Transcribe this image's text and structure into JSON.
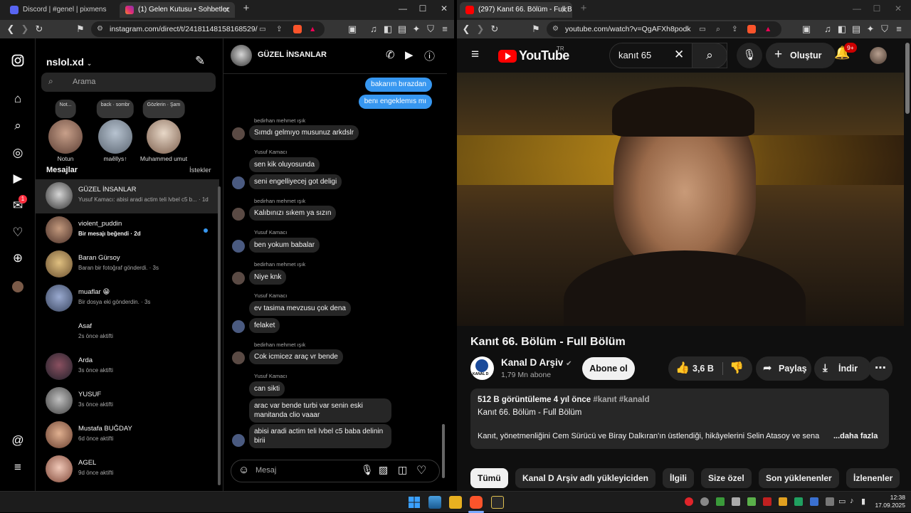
{
  "left_browser": {
    "tabs": [
      {
        "label": "Discord | #genel | pixmens"
      },
      {
        "label": "(1) Gelen Kutusu • Sohbetler"
      }
    ],
    "url": "instagram.com/direct/t/24181148158168529/"
  },
  "instagram": {
    "username": "nslol.xd",
    "search_placeholder": "Arama",
    "rail_badge": "1",
    "notes": [
      {
        "bubble": "Not...",
        "name": "Notun"
      },
      {
        "bubble": "back · sombr",
        "name": "maêllys↑"
      },
      {
        "bubble": "Gözlerin · Şam",
        "name": "Muhammed umut"
      }
    ],
    "messages_heading": "Mesajlar",
    "requests_link": "İstekler",
    "conversations": [
      {
        "name": "GÜZEL İNSANLAR",
        "snippet": "Yusuf Kamacı: abisi aradi actim teli lvbel c5 b... · 1d",
        "bold": false
      },
      {
        "name": "violent_puddin",
        "snippet": "Bir mesajı beğendi · 2d",
        "bold": true
      },
      {
        "name": "Baran Gürsoy",
        "snippet": "Baran bir fotoğraf gönderdi. · 3s",
        "bold": false
      },
      {
        "name": "muaflar 😁",
        "snippet": "Bir dosya eki gönderdin. · 3s",
        "bold": false
      },
      {
        "name": "Asaf",
        "snippet": "2s önce aktifti",
        "bold": false
      },
      {
        "name": "Arda",
        "snippet": "3s önce aktifti",
        "bold": false
      },
      {
        "name": "YUSUF",
        "snippet": "3s önce aktifti",
        "bold": false
      },
      {
        "name": "Mustafa BUĞDAY",
        "snippet": "6d önce aktifti",
        "bold": false
      },
      {
        "name": "AGEL",
        "snippet": "9d önce aktifti",
        "bold": false
      }
    ],
    "chat": {
      "title": "GÜZEL İNSANLAR",
      "input_placeholder": "Mesaj",
      "my_messages": [
        "bakarım bırazdan",
        "benı engeklemıs mı"
      ],
      "messages": [
        {
          "sender": "bedirhan mehmet ışık",
          "text": "Sımdı gelmıyo musunuz arkdslr"
        },
        {
          "sender": "Yusuf Kamacı",
          "text": "sen kik oluyosunda"
        },
        {
          "sender": "",
          "text": "seni engelliyecej got deligi"
        },
        {
          "sender": "bedirhan mehmet ışık",
          "text": "Kalıbınızı sıkem ya sızın"
        },
        {
          "sender": "Yusuf Kamacı",
          "text": "ben yokum babalar"
        },
        {
          "sender": "bedirhan mehmet ışık",
          "text": "Niye knk"
        },
        {
          "sender": "Yusuf Kamacı",
          "text": "ev tasima mevzusu çok dena"
        },
        {
          "sender": "",
          "text": "felaket"
        },
        {
          "sender": "bedirhan mehmet ışık",
          "text": "Cok icmicez araç vr bende"
        },
        {
          "sender": "Yusuf Kamacı",
          "text": "can sikti"
        },
        {
          "sender": "",
          "text": "arac var bende turbi var senin eski manitanda clio vaaar"
        },
        {
          "sender": "",
          "text": "abisi aradi actim teli lvbel c5 baba delinin birii"
        }
      ]
    }
  },
  "right_browser": {
    "tab": "(297) Kanıt 66. Bölüm - Full B...",
    "url": "youtube.com/watch?v=QgAFXh8podk"
  },
  "youtube": {
    "logo_text": "YouTube",
    "region": "TR",
    "search_value": "kanıt 65",
    "create_label": "Oluştur",
    "notif_count": "9+",
    "title": "Kanıt 66. Bölüm - Full Bölüm",
    "channel": "Kanal D Arşiv",
    "channel_logo_text": "KANAL D",
    "subs": "1,79 Mn abone",
    "subscribe": "Abone ol",
    "likes": "3,6 B",
    "share": "Paylaş",
    "download": "İndir",
    "desc_stats": "512 B görüntüleme  4 yıl önce",
    "desc_tags": "#kanıt #kanald",
    "desc_line2": "Kanıt 66. Bölüm - Full Bölüm",
    "desc_line3": "Kanıt, yönetmenliğini Cem Sürücü ve Biray Dalkıran'ın üstlendiği, hikâyelerini Selin Atasoy ve sena",
    "desc_more": "...daha fazla",
    "chips": [
      "Tümü",
      "Kanal D Arşiv adlı yükleyiciden",
      "İlgili",
      "Size özel",
      "Son yüklenenler",
      "İzlenenler"
    ]
  },
  "taskbar": {
    "time": "12:38",
    "date": "17.09.2025"
  },
  "colors": {
    "ig_blue": "#3797f0",
    "yt_red": "#ff0000",
    "bg_dark": "#0f0f0f"
  }
}
